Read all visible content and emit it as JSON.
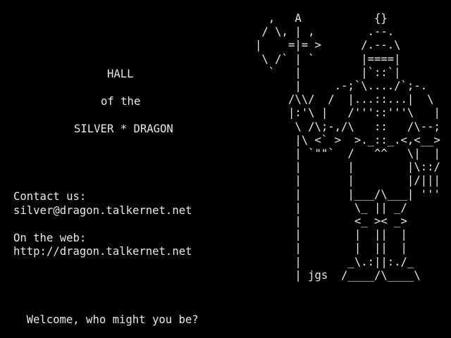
{
  "screen": {
    "background": "#000000",
    "foreground": "#e8e8e8"
  },
  "title": {
    "line1": "HALL",
    "line2": "of the",
    "line3": "SILVER * DRAGON"
  },
  "contact": {
    "heading": "Contact us:",
    "email": "silver@dragon.talkernet.net"
  },
  "web": {
    "heading": "On the web:",
    "url": "http://dragon.talkernet.net"
  },
  "art": {
    "lines": [
      "  ,   A           {}",
      " / \\, | ,        .--.",
      "|    =|= >      /.--.\\",
      " \\ /` | `       |====|",
      "  `   |         |`::`|",
      "      |     .-;`\\..../`;-.",
      "     /\\\\/  /  |...::...|  \\",
      "     |:'\\ |   /'''::'''\\   |",
      "      \\ /\\;-,/\\   ::   /\\--;",
      "      |\\ <` >  >._::_.<,<__>",
      "      | `\"\"`  /   ^^   \\|  |",
      "      |       |        |\\::/",
      "      |       |        |/|||",
      "      |       |___/\\___| '''",
      "      |        \\_ || _/",
      "      |        <_ >< _>",
      "      |        |  ||  |",
      "      |        |  ||  |",
      "      |       _\\.:||:./_",
      "      | jgs  /____/\\____\\"
    ]
  },
  "prompt": {
    "text": "Welcome, who might you be?",
    "input_value": ""
  }
}
